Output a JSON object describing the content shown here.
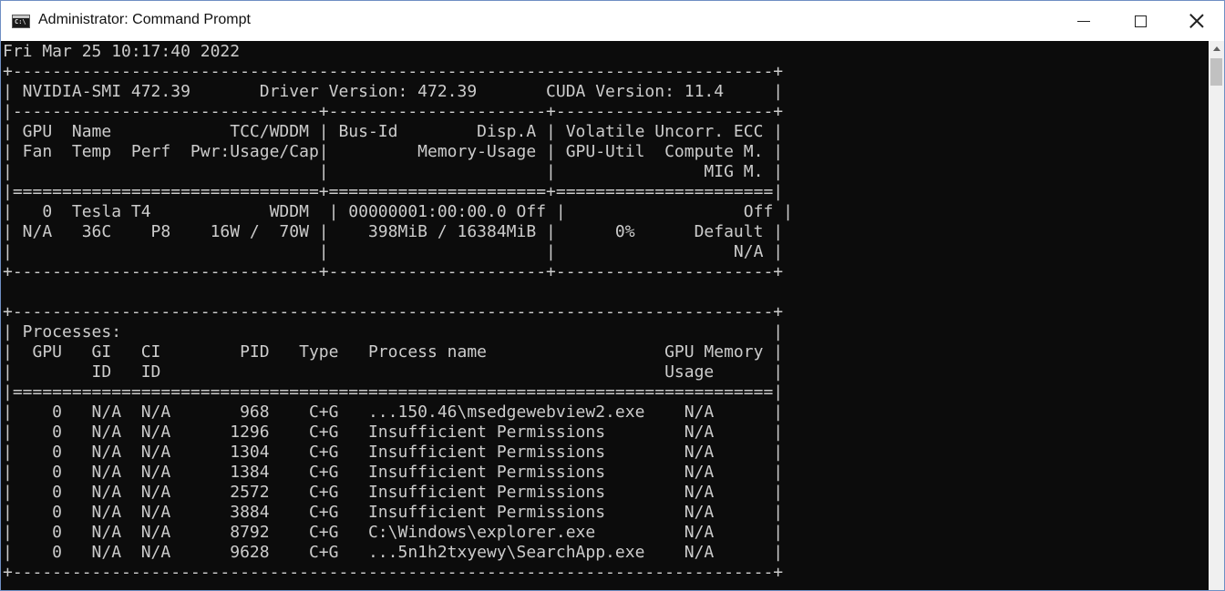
{
  "window": {
    "title": "Administrator: Command Prompt",
    "icon_label": "C:\\",
    "controls": {
      "minimize": "minimize",
      "maximize": "maximize",
      "close": "close"
    }
  },
  "console": {
    "lines": [
      "Fri Mar 25 10:17:40 2022",
      "+-----------------------------------------------------------------------------+",
      "| NVIDIA-SMI 472.39       Driver Version: 472.39       CUDA Version: 11.4     |",
      "|-------------------------------+----------------------+----------------------+",
      "| GPU  Name            TCC/WDDM | Bus-Id        Disp.A | Volatile Uncorr. ECC |",
      "| Fan  Temp  Perf  Pwr:Usage/Cap|         Memory-Usage | GPU-Util  Compute M. |",
      "|                               |                      |               MIG M. |",
      "|===============================+======================+======================|",
      "|   0  Tesla T4            WDDM  | 00000001:00:00.0 Off |                  Off |",
      "| N/A   36C    P8    16W /  70W |    398MiB / 16384MiB |      0%      Default |",
      "|                               |                      |                  N/A |",
      "+-------------------------------+----------------------+----------------------+",
      "",
      "+-----------------------------------------------------------------------------+",
      "| Processes:                                                                  |",
      "|  GPU   GI   CI        PID   Type   Process name                  GPU Memory |",
      "|        ID   ID                                                   Usage      |",
      "|=============================================================================|",
      "|    0   N/A  N/A       968    C+G   ...150.46\\msedgewebview2.exe    N/A      |",
      "|    0   N/A  N/A      1296    C+G   Insufficient Permissions        N/A      |",
      "|    0   N/A  N/A      1304    C+G   Insufficient Permissions        N/A      |",
      "|    0   N/A  N/A      1384    C+G   Insufficient Permissions        N/A      |",
      "|    0   N/A  N/A      2572    C+G   Insufficient Permissions        N/A      |",
      "|    0   N/A  N/A      3884    C+G   Insufficient Permissions        N/A      |",
      "|    0   N/A  N/A      8792    C+G   C:\\Windows\\explorer.exe         N/A      |",
      "|    0   N/A  N/A      9628    C+G   ...5n1h2txyewy\\SearchApp.exe    N/A      |",
      "+-----------------------------------------------------------------------------+"
    ]
  }
}
